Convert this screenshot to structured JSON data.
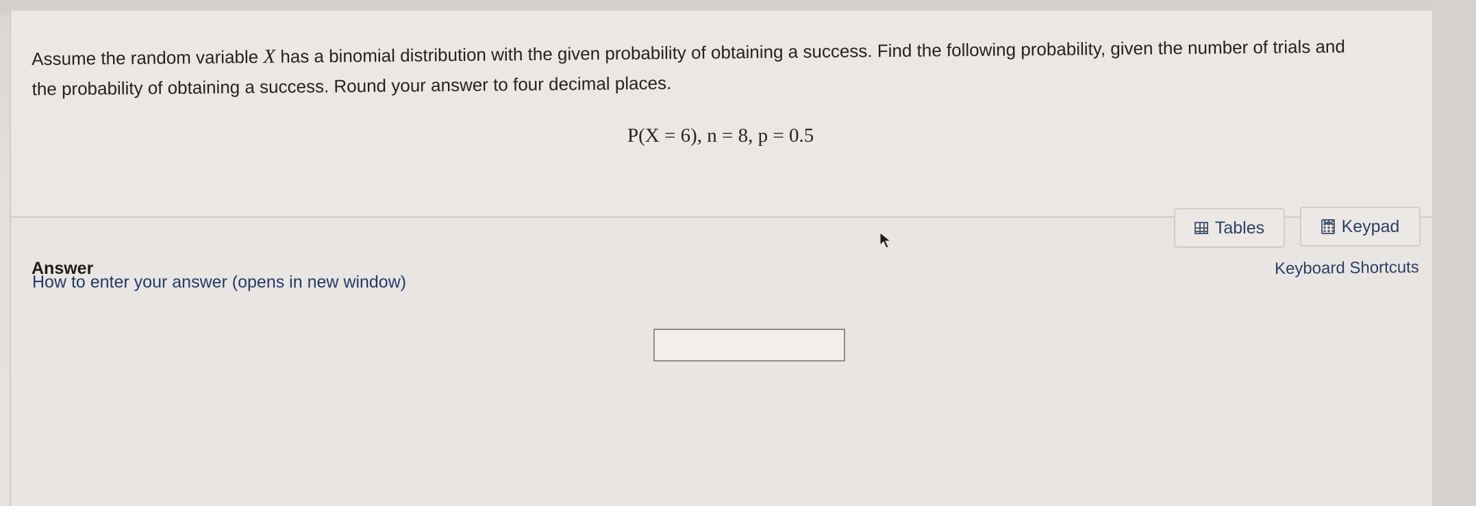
{
  "question": {
    "text_before_var": "Assume the random variable ",
    "variable": "X",
    "text_line1_after": " has a binomial distribution with the given probability of obtaining a success. Find the following probability, given the number of trials and",
    "text_line2": "the probability of obtaining a success. Round your answer to four decimal places.",
    "formula": "P(X = 6), n = 8, p = 0.5"
  },
  "answer": {
    "label": "Answer",
    "how_to_link": "How to enter your answer (opens in new window)",
    "input_value": "",
    "input_placeholder": ""
  },
  "tools": {
    "tables_label": "Tables",
    "tables_icon": "table-grid-icon",
    "keypad_label": "Keypad",
    "keypad_icon": "calculator-icon",
    "shortcuts_label": "Keyboard Shortcuts"
  },
  "colors": {
    "link": "#233a6a",
    "panel_bg": "#e9e5e2",
    "text": "#232323"
  }
}
